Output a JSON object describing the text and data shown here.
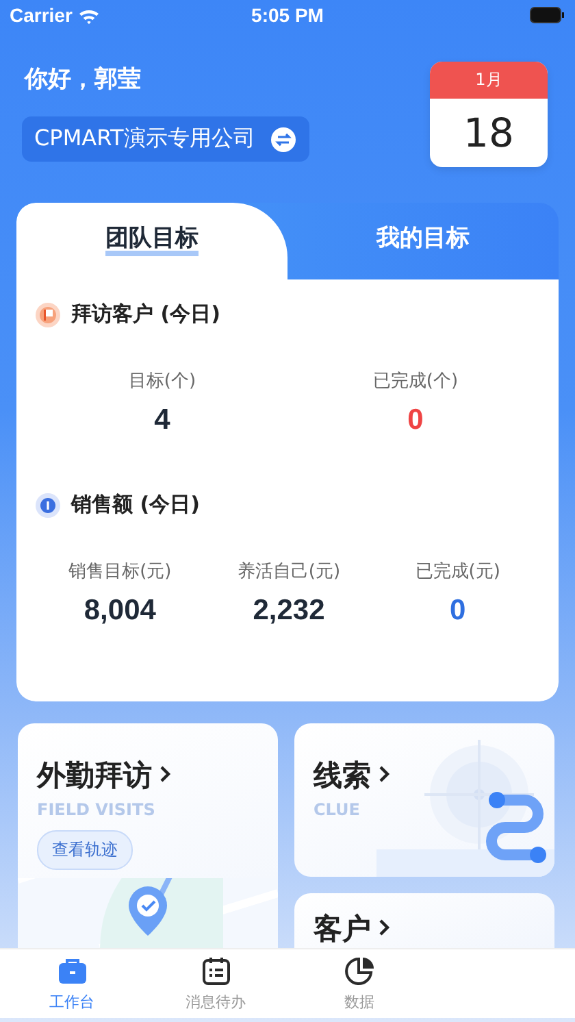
{
  "status_bar": {
    "carrier": "Carrier",
    "time": "5:05 PM"
  },
  "header": {
    "greeting": "你好，郭莹",
    "company": "CPMART演示专用公司",
    "calendar": {
      "month": "1月",
      "day": "18"
    }
  },
  "goals": {
    "tabs": [
      {
        "label": "团队目标",
        "selected": true
      },
      {
        "label": "我的目标",
        "selected": false
      }
    ],
    "sections": [
      {
        "title": "拜访客户 (今日)",
        "metrics": [
          {
            "label": "目标(个)",
            "value": "4",
            "color": "#1f2937"
          },
          {
            "label": "已完成(个)",
            "value": "0",
            "color": "#ef4444"
          }
        ]
      },
      {
        "title": "销售额 (今日)",
        "metrics": [
          {
            "label": "销售目标(元)",
            "value": "8,004",
            "color": "#1f2937"
          },
          {
            "label": "养活自己(元)",
            "value": "2,232",
            "color": "#1f2937"
          },
          {
            "label": "已完成(元)",
            "value": "0",
            "color": "#2f6fe0"
          }
        ]
      }
    ]
  },
  "tiles": [
    {
      "kind": "visits",
      "title": "外勤拜访",
      "subtitle": "FIELD VISITS",
      "action": "查看轨迹"
    },
    {
      "kind": "clue",
      "title": "线索",
      "subtitle": "CLUE"
    },
    {
      "kind": "customer",
      "title": "客户"
    }
  ],
  "nav": [
    {
      "label": "工作台",
      "selected": true
    },
    {
      "label": "消息待办",
      "selected": false
    },
    {
      "label": "数据",
      "selected": false
    }
  ]
}
